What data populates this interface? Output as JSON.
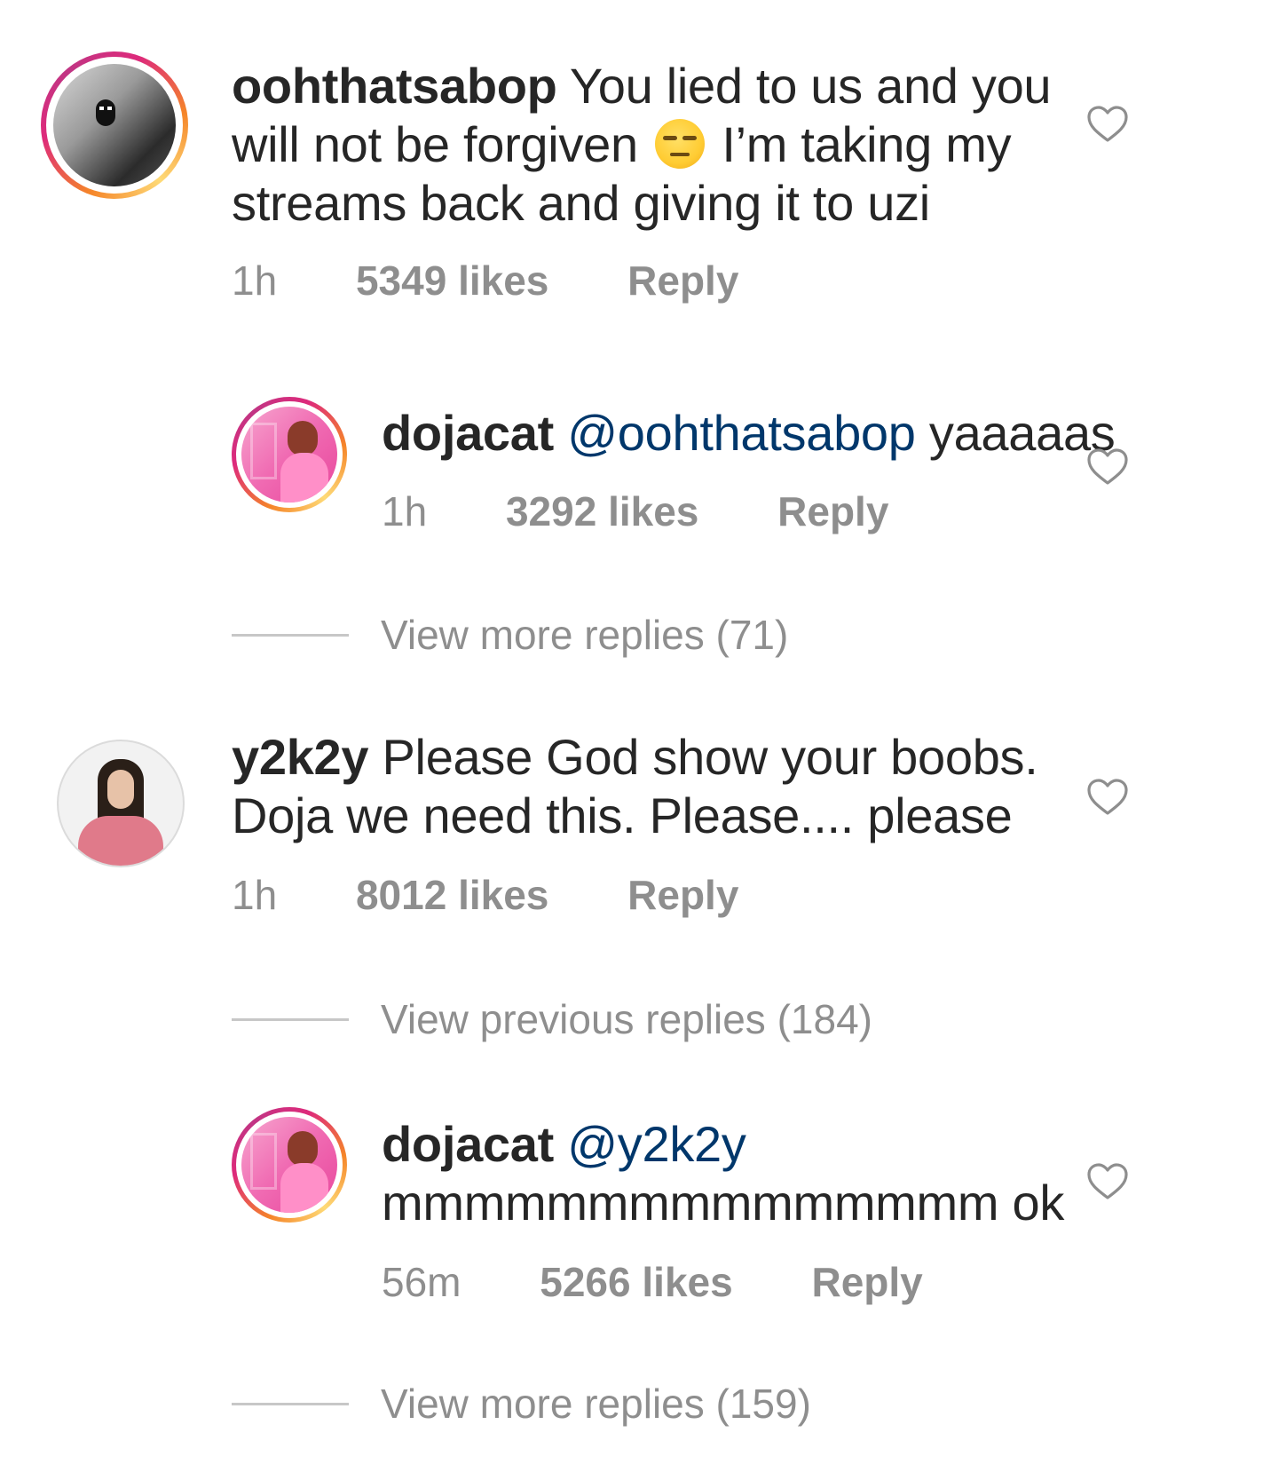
{
  "comments": [
    {
      "username": "oohthatsabop",
      "text_before": "You lied to us and you will not be forgiven",
      "emoji": "unamused-face-emoji",
      "text_after": "I’m taking my streams back and giving it to uzi",
      "time": "1h",
      "likes": "5349 likes",
      "reply": "Reply"
    },
    {
      "username": "dojacat",
      "mention": "@oohthatsabop",
      "text": "yaaaaas",
      "time": "1h",
      "likes": "3292 likes",
      "reply": "Reply"
    },
    {
      "username": "y2k2y",
      "text": "Please God show your boobs. Doja we need this. Please.... please",
      "time": "1h",
      "likes": "8012 likes",
      "reply": "Reply"
    },
    {
      "username": "dojacat",
      "mention": "@y2k2y",
      "text": "mmmmmmmmmmmmmmm ok",
      "time": "56m",
      "likes": "5266 likes",
      "reply": "Reply"
    }
  ],
  "threads": [
    {
      "label": "View more replies (71)"
    },
    {
      "label": "View previous replies (184)"
    },
    {
      "label": "View more replies (159)"
    }
  ],
  "colors": {
    "text": "#262626",
    "meta": "#8e8e8e",
    "mention": "#00376b"
  },
  "icons": {
    "like": "heart-outline-icon"
  }
}
